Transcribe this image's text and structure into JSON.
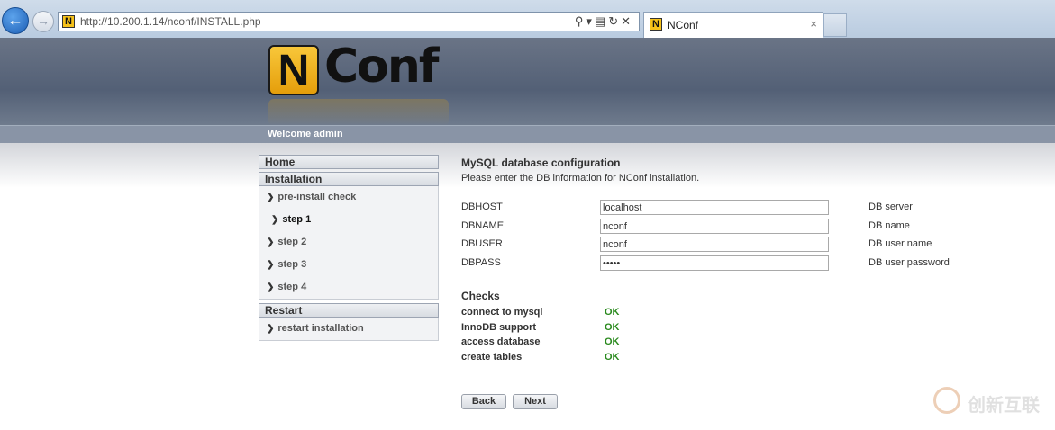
{
  "browser": {
    "url": "http://10.200.1.14/nconf/INSTALL.php",
    "tab_title": "NConf",
    "favicon_letter": "N",
    "close_glyph": "×"
  },
  "header": {
    "logo_n": "N",
    "logo_conf": "Conf",
    "welcome": "Welcome admin"
  },
  "sidebar": {
    "home": "Home",
    "installation": "Installation",
    "install_items": [
      "pre-install check",
      "step 1",
      "step 2",
      "step 3",
      "step 4"
    ],
    "active_item": "step 1",
    "restart": "Restart",
    "restart_item": "restart installation"
  },
  "main": {
    "title": "MySQL database configuration",
    "subtitle": "Please enter the DB information for NConf installation.",
    "fields": [
      {
        "label": "DBHOST",
        "value": "localhost",
        "desc": "DB server"
      },
      {
        "label": "DBNAME",
        "value": "nconf",
        "desc": "DB name"
      },
      {
        "label": "DBUSER",
        "value": "nconf",
        "desc": "DB user name"
      },
      {
        "label": "DBPASS",
        "value": "•••••",
        "desc": "DB user password"
      }
    ],
    "checks_title": "Checks",
    "checks": [
      {
        "label": "connect to mysql",
        "status": "OK"
      },
      {
        "label": "InnoDB support",
        "status": "OK"
      },
      {
        "label": "access database",
        "status": "OK"
      },
      {
        "label": "create tables",
        "status": "OK"
      }
    ],
    "back_label": "Back",
    "next_label": "Next"
  },
  "watermark": {
    "text": "创新互联"
  },
  "colors": {
    "ok": "#2a8a1e",
    "header": "#536076",
    "logo": "#f8c73a"
  }
}
